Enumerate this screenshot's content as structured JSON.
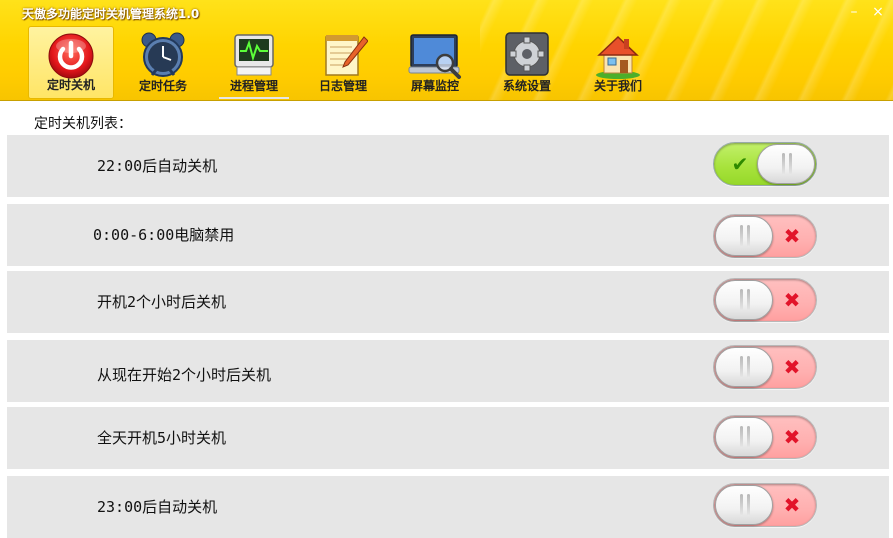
{
  "window": {
    "title": "天傲多功能定时关机管理系统1.0",
    "minimize_glyph": "–",
    "close_glyph": "×"
  },
  "toolbar": {
    "items": [
      {
        "label": "定时关机",
        "icon": "power-button-icon",
        "active": true
      },
      {
        "label": "定时任务",
        "icon": "alarm-clock-icon",
        "active": false
      },
      {
        "label": "进程管理",
        "icon": "process-monitor-icon",
        "active": false
      },
      {
        "label": "日志管理",
        "icon": "notepad-pencil-icon",
        "active": false
      },
      {
        "label": "屏幕监控",
        "icon": "screen-magnifier-icon",
        "active": false
      },
      {
        "label": "系统设置",
        "icon": "gear-settings-icon",
        "active": false
      },
      {
        "label": "关于我们",
        "icon": "house-icon",
        "active": false
      }
    ]
  },
  "main": {
    "list_title": "定时关机列表：",
    "rows": [
      {
        "label": "22:00后自动关机",
        "enabled": true
      },
      {
        "label": "0:00-6:00电脑禁用",
        "enabled": false
      },
      {
        "label": "开机2个小时后关机",
        "enabled": false
      },
      {
        "label": "从现在开始2个小时后关机",
        "enabled": false
      },
      {
        "label": "全天开机5小时关机",
        "enabled": false
      },
      {
        "label": "23:00后自动关机",
        "enabled": false
      }
    ],
    "on_mark": "✔",
    "off_mark": "✖"
  },
  "colors": {
    "header_yellow": "#ffd400",
    "row_background": "#e6e6e6",
    "switch_on": "#a6e23a",
    "switch_off": "#ffb0b0",
    "off_mark": "#e2142a"
  }
}
